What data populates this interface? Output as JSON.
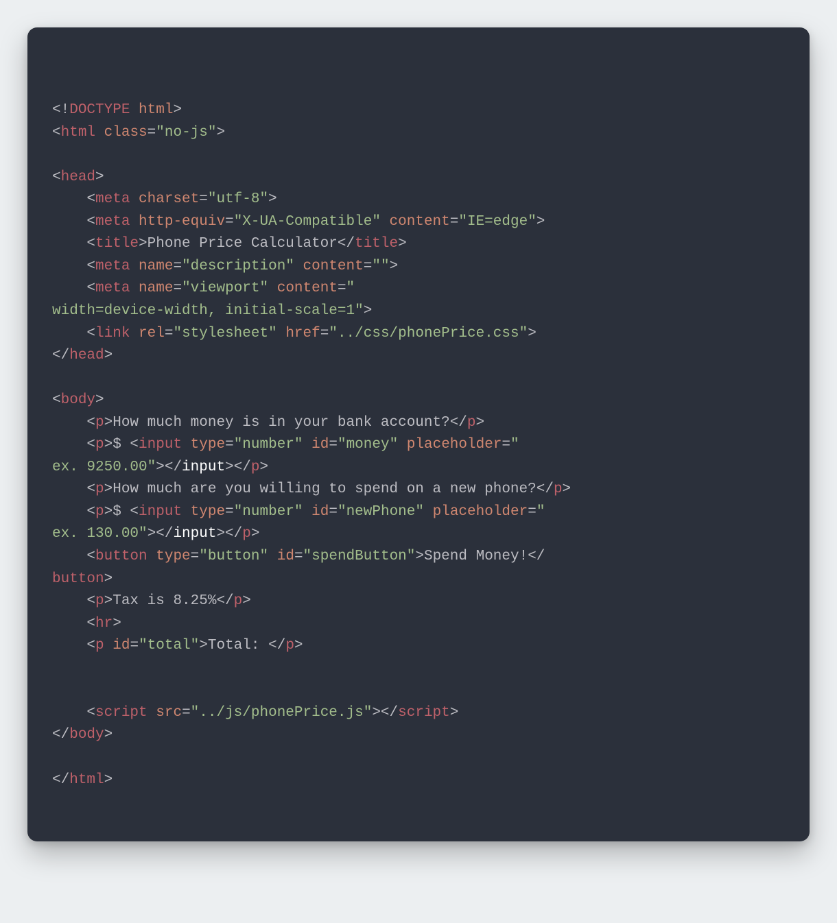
{
  "code": {
    "lines": [
      [
        {
          "cls": "pn",
          "t": "<!"
        },
        {
          "cls": "doctype",
          "t": "DOCTYPE"
        },
        {
          "cls": "pn",
          "t": " "
        },
        {
          "cls": "attr",
          "t": "html"
        },
        {
          "cls": "pn",
          "t": ">"
        }
      ],
      [
        {
          "cls": "pn",
          "t": "<"
        },
        {
          "cls": "tag",
          "t": "html"
        },
        {
          "cls": "pn",
          "t": " "
        },
        {
          "cls": "attr",
          "t": "class"
        },
        {
          "cls": "pn",
          "t": "="
        },
        {
          "cls": "str",
          "t": "\"no-js\""
        },
        {
          "cls": "pn",
          "t": ">"
        }
      ],
      [],
      [
        {
          "cls": "pn",
          "t": "<"
        },
        {
          "cls": "tag",
          "t": "head"
        },
        {
          "cls": "pn",
          "t": ">"
        }
      ],
      [
        {
          "cls": "pn",
          "t": "    <"
        },
        {
          "cls": "tag",
          "t": "meta"
        },
        {
          "cls": "pn",
          "t": " "
        },
        {
          "cls": "attr",
          "t": "charset"
        },
        {
          "cls": "pn",
          "t": "="
        },
        {
          "cls": "str",
          "t": "\"utf-8\""
        },
        {
          "cls": "pn",
          "t": ">"
        }
      ],
      [
        {
          "cls": "pn",
          "t": "    <"
        },
        {
          "cls": "tag",
          "t": "meta"
        },
        {
          "cls": "pn",
          "t": " "
        },
        {
          "cls": "attr",
          "t": "http-equiv"
        },
        {
          "cls": "pn",
          "t": "="
        },
        {
          "cls": "str",
          "t": "\"X-UA-Compatible\""
        },
        {
          "cls": "pn",
          "t": " "
        },
        {
          "cls": "attr",
          "t": "content"
        },
        {
          "cls": "pn",
          "t": "="
        },
        {
          "cls": "str",
          "t": "\"IE=edge\""
        },
        {
          "cls": "pn",
          "t": ">"
        }
      ],
      [
        {
          "cls": "pn",
          "t": "    <"
        },
        {
          "cls": "tag",
          "t": "title"
        },
        {
          "cls": "pn",
          "t": ">Phone Price Calculator</"
        },
        {
          "cls": "tag",
          "t": "title"
        },
        {
          "cls": "pn",
          "t": ">"
        }
      ],
      [
        {
          "cls": "pn",
          "t": "    <"
        },
        {
          "cls": "tag",
          "t": "meta"
        },
        {
          "cls": "pn",
          "t": " "
        },
        {
          "cls": "attr",
          "t": "name"
        },
        {
          "cls": "pn",
          "t": "="
        },
        {
          "cls": "str",
          "t": "\"description\""
        },
        {
          "cls": "pn",
          "t": " "
        },
        {
          "cls": "attr",
          "t": "content"
        },
        {
          "cls": "pn",
          "t": "="
        },
        {
          "cls": "str",
          "t": "\"\""
        },
        {
          "cls": "pn",
          "t": ">"
        }
      ],
      [
        {
          "cls": "pn",
          "t": "    <"
        },
        {
          "cls": "tag",
          "t": "meta"
        },
        {
          "cls": "pn",
          "t": " "
        },
        {
          "cls": "attr",
          "t": "name"
        },
        {
          "cls": "pn",
          "t": "="
        },
        {
          "cls": "str",
          "t": "\"viewport\""
        },
        {
          "cls": "pn",
          "t": " "
        },
        {
          "cls": "attr",
          "t": "content"
        },
        {
          "cls": "pn",
          "t": "="
        },
        {
          "cls": "str",
          "t": "\""
        }
      ],
      [
        {
          "cls": "str",
          "t": "width=device-width, initial-scale=1\""
        },
        {
          "cls": "pn",
          "t": ">"
        }
      ],
      [
        {
          "cls": "pn",
          "t": "    <"
        },
        {
          "cls": "tag",
          "t": "link"
        },
        {
          "cls": "pn",
          "t": " "
        },
        {
          "cls": "attr",
          "t": "rel"
        },
        {
          "cls": "pn",
          "t": "="
        },
        {
          "cls": "str",
          "t": "\"stylesheet\""
        },
        {
          "cls": "pn",
          "t": " "
        },
        {
          "cls": "attr",
          "t": "href"
        },
        {
          "cls": "pn",
          "t": "="
        },
        {
          "cls": "str",
          "t": "\"../css/phonePrice.css\""
        },
        {
          "cls": "pn",
          "t": ">"
        }
      ],
      [
        {
          "cls": "pn",
          "t": "</"
        },
        {
          "cls": "tag",
          "t": "head"
        },
        {
          "cls": "pn",
          "t": ">"
        }
      ],
      [],
      [
        {
          "cls": "pn",
          "t": "<"
        },
        {
          "cls": "tag",
          "t": "body"
        },
        {
          "cls": "pn",
          "t": ">"
        }
      ],
      [
        {
          "cls": "pn",
          "t": "    <"
        },
        {
          "cls": "tag",
          "t": "p"
        },
        {
          "cls": "pn",
          "t": ">How much money is in your bank account?</"
        },
        {
          "cls": "tag",
          "t": "p"
        },
        {
          "cls": "pn",
          "t": ">"
        }
      ],
      [
        {
          "cls": "pn",
          "t": "    <"
        },
        {
          "cls": "tag",
          "t": "p"
        },
        {
          "cls": "pn",
          "t": ">$ <"
        },
        {
          "cls": "tag",
          "t": "input"
        },
        {
          "cls": "pn",
          "t": " "
        },
        {
          "cls": "attr",
          "t": "type"
        },
        {
          "cls": "pn",
          "t": "="
        },
        {
          "cls": "str",
          "t": "\"number\""
        },
        {
          "cls": "pn",
          "t": " "
        },
        {
          "cls": "attr",
          "t": "id"
        },
        {
          "cls": "pn",
          "t": "="
        },
        {
          "cls": "str",
          "t": "\"money\""
        },
        {
          "cls": "pn",
          "t": " "
        },
        {
          "cls": "attr",
          "t": "placeholder"
        },
        {
          "cls": "pn",
          "t": "="
        },
        {
          "cls": "str",
          "t": "\""
        }
      ],
      [
        {
          "cls": "str",
          "t": "ex. 9250.00\""
        },
        {
          "cls": "pn",
          "t": "></"
        },
        {
          "cls": "kw",
          "t": "input"
        },
        {
          "cls": "pn",
          "t": "></"
        },
        {
          "cls": "tag",
          "t": "p"
        },
        {
          "cls": "pn",
          "t": ">"
        }
      ],
      [
        {
          "cls": "pn",
          "t": "    <"
        },
        {
          "cls": "tag",
          "t": "p"
        },
        {
          "cls": "pn",
          "t": ">How much are you willing to spend on a new phone?</"
        },
        {
          "cls": "tag",
          "t": "p"
        },
        {
          "cls": "pn",
          "t": ">"
        }
      ],
      [
        {
          "cls": "pn",
          "t": "    <"
        },
        {
          "cls": "tag",
          "t": "p"
        },
        {
          "cls": "pn",
          "t": ">$ <"
        },
        {
          "cls": "tag",
          "t": "input"
        },
        {
          "cls": "pn",
          "t": " "
        },
        {
          "cls": "attr",
          "t": "type"
        },
        {
          "cls": "pn",
          "t": "="
        },
        {
          "cls": "str",
          "t": "\"number\""
        },
        {
          "cls": "pn",
          "t": " "
        },
        {
          "cls": "attr",
          "t": "id"
        },
        {
          "cls": "pn",
          "t": "="
        },
        {
          "cls": "str",
          "t": "\"newPhone\""
        },
        {
          "cls": "pn",
          "t": " "
        },
        {
          "cls": "attr",
          "t": "placeholder"
        },
        {
          "cls": "pn",
          "t": "="
        },
        {
          "cls": "str",
          "t": "\""
        }
      ],
      [
        {
          "cls": "str",
          "t": "ex. 130.00\""
        },
        {
          "cls": "pn",
          "t": "></"
        },
        {
          "cls": "kw",
          "t": "input"
        },
        {
          "cls": "pn",
          "t": "></"
        },
        {
          "cls": "tag",
          "t": "p"
        },
        {
          "cls": "pn",
          "t": ">"
        }
      ],
      [
        {
          "cls": "pn",
          "t": "    <"
        },
        {
          "cls": "tag",
          "t": "button"
        },
        {
          "cls": "pn",
          "t": " "
        },
        {
          "cls": "attr",
          "t": "type"
        },
        {
          "cls": "pn",
          "t": "="
        },
        {
          "cls": "str",
          "t": "\"button\""
        },
        {
          "cls": "pn",
          "t": " "
        },
        {
          "cls": "attr",
          "t": "id"
        },
        {
          "cls": "pn",
          "t": "="
        },
        {
          "cls": "str",
          "t": "\"spendButton\""
        },
        {
          "cls": "pn",
          "t": ">Spend Money!</"
        }
      ],
      [
        {
          "cls": "tag",
          "t": "button"
        },
        {
          "cls": "pn",
          "t": ">"
        }
      ],
      [
        {
          "cls": "pn",
          "t": "    <"
        },
        {
          "cls": "tag",
          "t": "p"
        },
        {
          "cls": "pn",
          "t": ">Tax is 8.25%</"
        },
        {
          "cls": "tag",
          "t": "p"
        },
        {
          "cls": "pn",
          "t": ">"
        }
      ],
      [
        {
          "cls": "pn",
          "t": "    <"
        },
        {
          "cls": "tag",
          "t": "hr"
        },
        {
          "cls": "pn",
          "t": ">"
        }
      ],
      [
        {
          "cls": "pn",
          "t": "    <"
        },
        {
          "cls": "tag",
          "t": "p"
        },
        {
          "cls": "pn",
          "t": " "
        },
        {
          "cls": "attr",
          "t": "id"
        },
        {
          "cls": "pn",
          "t": "="
        },
        {
          "cls": "str",
          "t": "\"total\""
        },
        {
          "cls": "pn",
          "t": ">Total: </"
        },
        {
          "cls": "tag",
          "t": "p"
        },
        {
          "cls": "pn",
          "t": ">"
        }
      ],
      [],
      [],
      [
        {
          "cls": "pn",
          "t": "    <"
        },
        {
          "cls": "tag",
          "t": "script"
        },
        {
          "cls": "pn",
          "t": " "
        },
        {
          "cls": "attr",
          "t": "src"
        },
        {
          "cls": "pn",
          "t": "="
        },
        {
          "cls": "str",
          "t": "\"../js/phonePrice.js\""
        },
        {
          "cls": "pn",
          "t": "></"
        },
        {
          "cls": "tag",
          "t": "script"
        },
        {
          "cls": "pn",
          "t": ">"
        }
      ],
      [
        {
          "cls": "pn",
          "t": "</"
        },
        {
          "cls": "tag",
          "t": "body"
        },
        {
          "cls": "pn",
          "t": ">"
        }
      ],
      [],
      [
        {
          "cls": "pn",
          "t": "</"
        },
        {
          "cls": "tag",
          "t": "html"
        },
        {
          "cls": "pn",
          "t": ">"
        }
      ]
    ]
  }
}
